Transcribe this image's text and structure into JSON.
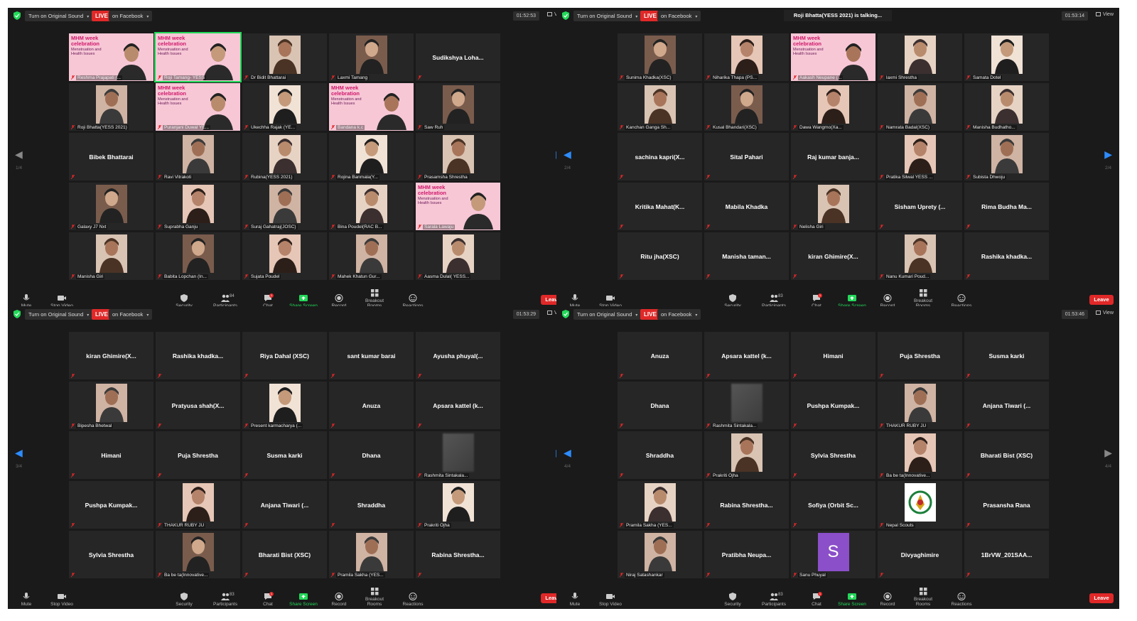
{
  "common": {
    "original_sound": "Turn on Original Sound",
    "live": "LIVE",
    "facebook": "on Facebook",
    "view": "View",
    "toolbar": {
      "mute": "Mute",
      "stop_video": "Stop Video",
      "security": "Security",
      "participants": "Participants",
      "chat": "Chat",
      "share_screen": "Share Screen",
      "record": "Record",
      "breakout": "Breakout Rooms",
      "reactions": "Reactions",
      "leave": "Leave"
    },
    "banner_title": "MHM week celebration",
    "banner_sub": "Menstruation and Health Issues",
    "accent_green": "#23d959",
    "accent_blue": "#2d8cff",
    "leave_red": "#e02828"
  },
  "windows": [
    {
      "timer": "01:52:53",
      "participants_count": "84",
      "chat_badge": "1",
      "page": "1/4",
      "talking": "",
      "tiles": [
        {
          "label": "Reshma Prajapati (...",
          "kind": "banner-photo"
        },
        {
          "label": "Roji Tamang- YESS",
          "kind": "banner-photo",
          "highlight": true
        },
        {
          "label": "Dr Bidit Bhattarai",
          "kind": "photo"
        },
        {
          "label": "Laxmi Tamang",
          "kind": "photo"
        },
        {
          "name": "Sudikshya Loha...",
          "kind": "name"
        },
        {
          "label": "Roji Bhatta(YESS 2021)",
          "kind": "photo"
        },
        {
          "label": "Puranjani Duwal YE...",
          "kind": "banner-photo"
        },
        {
          "label": "Ukechha Rajak (YE...",
          "kind": "photo"
        },
        {
          "label": "Bandana k.c",
          "kind": "banner-photo"
        },
        {
          "label": "Saw Ruh",
          "kind": "photo"
        },
        {
          "name": "Bibek Bhattarai",
          "kind": "name"
        },
        {
          "label": "Ravi Vitrakoti",
          "kind": "photo"
        },
        {
          "label": "Rubina(YESS 2021)",
          "kind": "photo"
        },
        {
          "label": "Rojina Banmala(Y...",
          "kind": "photo"
        },
        {
          "label": "Prasamsha Shrestha",
          "kind": "photo"
        },
        {
          "label": "Galaxy J7 Nxt",
          "kind": "photo"
        },
        {
          "label": "Suprabha Ganju",
          "kind": "photo"
        },
        {
          "label": "Suraj Gahatraj(JOSC)",
          "kind": "photo"
        },
        {
          "label": "Bina Poudel(RAC B...",
          "kind": "photo"
        },
        {
          "label": "Sarala Lawaju",
          "kind": "banner-photo"
        },
        {
          "label": "Manisha Giri",
          "kind": "photo"
        },
        {
          "label": "Babita Lopchan (In...",
          "kind": "photo"
        },
        {
          "label": "Sujata Poudel",
          "kind": "photo"
        },
        {
          "label": "Mahek Khatun Gur...",
          "kind": "photo"
        },
        {
          "label": "Aasma Dulal( YESS...",
          "kind": "photo"
        }
      ]
    },
    {
      "timer": "01:53:14",
      "participants_count": "83",
      "chat_badge": "1",
      "page": "2/4",
      "talking": "Roji Bhatta(YESS 2021) is talking...",
      "tiles": [
        {
          "label": "Sunima Khadka(XSC)",
          "kind": "photo"
        },
        {
          "label": "Niharika Thapa (PS...",
          "kind": "photo"
        },
        {
          "label": "Aakash Neupane (...",
          "kind": "banner-photo"
        },
        {
          "label": "laxmi Shrestha",
          "kind": "photo"
        },
        {
          "label": "Samata Dotel",
          "kind": "photo"
        },
        {
          "label": "Kanchan Ganga Sh...",
          "kind": "photo"
        },
        {
          "label": "Kusal Bhandari(XSC)",
          "kind": "photo"
        },
        {
          "label": "Dawa Wangmo(Xa...",
          "kind": "photo"
        },
        {
          "label": "Namrata Badal(XSC)",
          "kind": "photo"
        },
        {
          "label": "Manisha Budhatho...",
          "kind": "photo"
        },
        {
          "name": "sachina kapri(X...",
          "kind": "name"
        },
        {
          "name": "Sital Pahari",
          "kind": "name"
        },
        {
          "name": "Raj kumar banja...",
          "kind": "name"
        },
        {
          "label": "Pratika Silwal YESS ...",
          "kind": "photo"
        },
        {
          "label": "Subista Dhwoju",
          "kind": "photo"
        },
        {
          "name": "Kritika Mahat(K...",
          "kind": "name"
        },
        {
          "name": "Mabila Khadka",
          "kind": "name"
        },
        {
          "label": "Nelisha Giri",
          "kind": "photo"
        },
        {
          "name": "Sisham Uprety (...",
          "kind": "name"
        },
        {
          "name": "Rima Budha Ma...",
          "kind": "name"
        },
        {
          "name": "Ritu jha(XSC)",
          "kind": "name"
        },
        {
          "name": "Manisha taman...",
          "kind": "name"
        },
        {
          "name": "kiran Ghimire(X...",
          "kind": "name"
        },
        {
          "label": "Nanu Kumari Poud...",
          "kind": "photo"
        },
        {
          "name": "Rashika khadka...",
          "kind": "name"
        }
      ]
    },
    {
      "timer": "01:53:29",
      "participants_count": "83",
      "chat_badge": "1",
      "page": "3/4",
      "talking": "",
      "tiles": [
        {
          "name": "kiran Ghimire(X...",
          "kind": "name"
        },
        {
          "name": "Rashika khadka...",
          "kind": "name"
        },
        {
          "name": "Riya Dahal (XSC)",
          "kind": "name"
        },
        {
          "name": "sant kumar barai",
          "kind": "name"
        },
        {
          "name": "Ayusha phuyal(...",
          "kind": "name"
        },
        {
          "label": "Bipesha Bhetwal",
          "kind": "photo"
        },
        {
          "name": "Pratyusa shah(X...",
          "kind": "name"
        },
        {
          "label": "Present karmacharya (...",
          "kind": "photo"
        },
        {
          "name": "Anuza",
          "kind": "name"
        },
        {
          "name": "Apsara kattel (k...",
          "kind": "name"
        },
        {
          "name": "Himani",
          "kind": "name"
        },
        {
          "name": "Puja Shrestha",
          "kind": "name"
        },
        {
          "name": "Susma karki",
          "kind": "name"
        },
        {
          "name": "Dhana",
          "kind": "name"
        },
        {
          "label": "Rashmita Sintakala...",
          "kind": "blur"
        },
        {
          "name": "Pushpa Kumpak...",
          "kind": "name"
        },
        {
          "label": "THAKUR RUBY JU",
          "kind": "photo"
        },
        {
          "name": "Anjana Tiwari (...",
          "kind": "name"
        },
        {
          "name": "Shraddha",
          "kind": "name"
        },
        {
          "label": "Prakriti Ojha",
          "kind": "photo"
        },
        {
          "name": "Sylvia Shrestha",
          "kind": "name"
        },
        {
          "label": "Ba be ta(Innovative...",
          "kind": "photo"
        },
        {
          "name": "Bharati Bist (XSC)",
          "kind": "name"
        },
        {
          "label": "Pramila Sakha (YES...",
          "kind": "photo"
        },
        {
          "name": "Rabina Shrestha...",
          "kind": "name"
        }
      ]
    },
    {
      "timer": "01:53:46",
      "participants_count": "83",
      "chat_badge": "1",
      "page": "4/4",
      "talking": "",
      "tiles": [
        {
          "name": "Anuza",
          "kind": "name"
        },
        {
          "name": "Apsara kattel (k...",
          "kind": "name"
        },
        {
          "name": "Himani",
          "kind": "name"
        },
        {
          "name": "Puja Shrestha",
          "kind": "name"
        },
        {
          "name": "Susma karki",
          "kind": "name"
        },
        {
          "name": "Dhana",
          "kind": "name"
        },
        {
          "label": "Rashmita Sintakala...",
          "kind": "blur"
        },
        {
          "name": "Pushpa Kumpak...",
          "kind": "name"
        },
        {
          "label": "THAKUR RUBY JU",
          "kind": "photo"
        },
        {
          "name": "Anjana Tiwari (...",
          "kind": "name"
        },
        {
          "name": "Shraddha",
          "kind": "name"
        },
        {
          "label": "Prakriti Ojha",
          "kind": "photo"
        },
        {
          "name": "Sylvia Shrestha",
          "kind": "name"
        },
        {
          "label": "Ba be ta(Innovative...",
          "kind": "photo"
        },
        {
          "name": "Bharati Bist (XSC)",
          "kind": "name"
        },
        {
          "label": "Pramila Sakha (YES...",
          "kind": "photo"
        },
        {
          "name": "Rabina Shrestha...",
          "kind": "name"
        },
        {
          "name": "Sofiya (Orbit Sc...",
          "kind": "name"
        },
        {
          "label": "Nepal Scouts",
          "kind": "logo"
        },
        {
          "name": "Prasansha Rana",
          "kind": "name"
        },
        {
          "label": "Niraj Satashankar",
          "kind": "photo"
        },
        {
          "name": "Pratibha Neupa...",
          "kind": "name"
        },
        {
          "label": "Sanu Phuyal",
          "kind": "avatar",
          "initial": "S"
        },
        {
          "name": "Divyaghimire",
          "kind": "name"
        },
        {
          "name": "1BrVW_201SAA...",
          "kind": "name"
        }
      ]
    }
  ]
}
